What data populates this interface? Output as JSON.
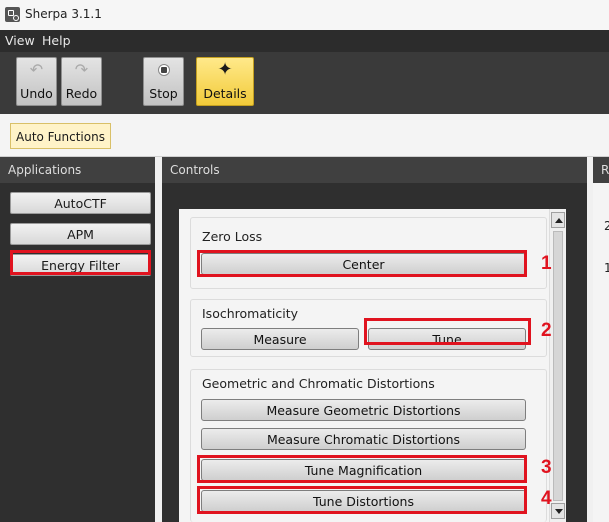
{
  "app": {
    "title": "Sherpa 3.1.1",
    "icon": "sherpa-app-icon"
  },
  "menu": [
    "View",
    "Help"
  ],
  "toolbar": {
    "undo": {
      "label": "Undo",
      "icon": "undo-icon",
      "enabled": false
    },
    "redo": {
      "label": "Redo",
      "icon": "redo-icon",
      "enabled": false
    },
    "stop": {
      "label": "Stop",
      "icon": "stop-icon"
    },
    "details": {
      "label": "Details",
      "icon": "details-star-icon",
      "active": true
    }
  },
  "function_tab": "Auto Functions",
  "applications": {
    "header": "Applications",
    "items": [
      "AutoCTF",
      "APM",
      "Energy Filter"
    ],
    "selected": "Energy Filter"
  },
  "controls": {
    "header": "Controls",
    "zero_loss": {
      "title": "Zero Loss",
      "center": "Center"
    },
    "isochromaticity": {
      "title": "Isochromaticity",
      "measure": "Measure",
      "tune": "Tune"
    },
    "distortions": {
      "title": "Geometric and Chromatic Distortions",
      "measure_geometric": "Measure Geometric Distortions",
      "measure_chromatic": "Measure Chromatic Distortions",
      "tune_magnification": "Tune Magnification",
      "tune_distortions": "Tune Distortions"
    }
  },
  "right_panel": {
    "header": "R",
    "values": [
      "2",
      "1"
    ]
  },
  "annotations": [
    "1",
    "2",
    "3",
    "4"
  ],
  "colors": {
    "highlight": "#e0131f",
    "active_toolbar": "#f2cb3a",
    "menubar": "#2c2c2c"
  }
}
